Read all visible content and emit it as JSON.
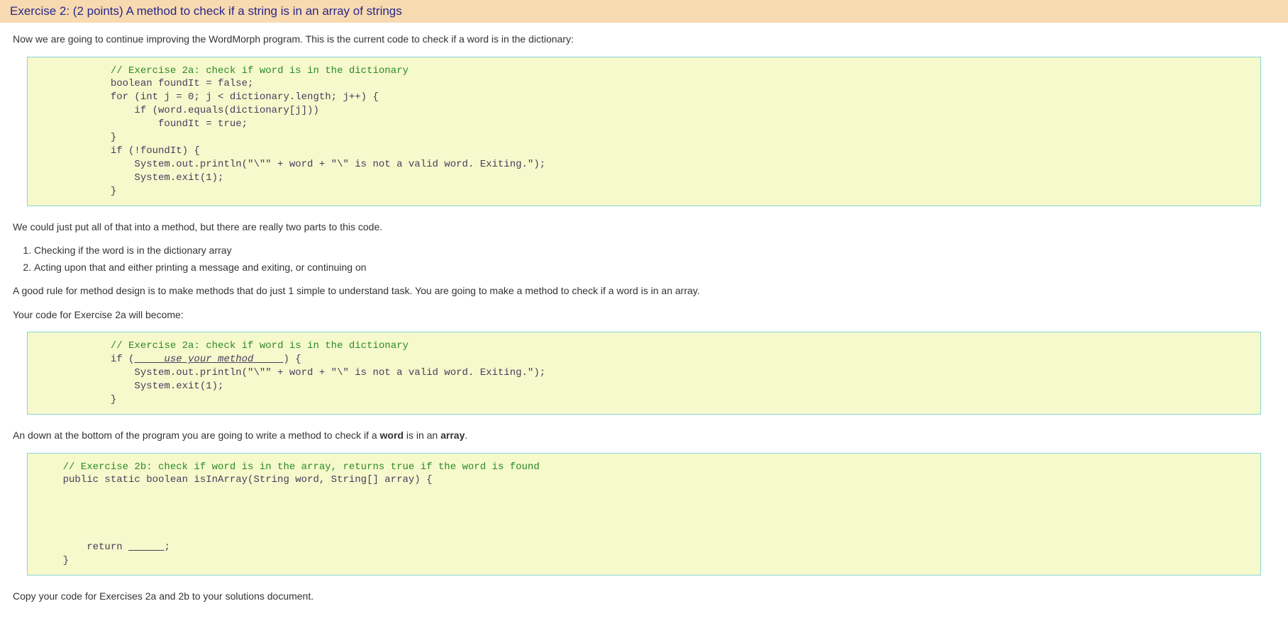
{
  "header": {
    "title": "Exercise 2: (2 points) A method to check if a string is in an array of strings"
  },
  "paragraphs": {
    "intro": "Now we are going to continue improving the WordMorph program. This is the current code to check if a word is in the dictionary:",
    "two_parts": "We could just put all of that into a method, but there are really two parts to this code.",
    "list_item_1": "Checking if the word is in the dictionary array",
    "list_item_2": "Acting upon that and either printing a message and exiting, or continuing on",
    "good_rule": "A good rule for method design is to make methods that do just 1 simple to understand task. You are going to make a method to check if a word is in an array.",
    "will_become": "Your code for Exercise 2a will become:",
    "bottom_pre": "An down at the bottom of the program you are going to write a method to check if a ",
    "bottom_word": "word",
    "bottom_mid": " is in an ",
    "bottom_array": "array",
    "bottom_end": ".",
    "copy_code": "Copy your code for Exercises 2a and 2b to your solutions document."
  },
  "code": {
    "block1_comment": "// Exercise 2a: check if word is in the dictionary",
    "block1_body": "            boolean foundIt = false;\n            for (int j = 0; j < dictionary.length; j++) {\n                if (word.equals(dictionary[j]))\n                    foundIt = true;\n            }\n            if (!foundIt) {\n                System.out.println(\"\\\"\" + word + \"\\\" is not a valid word. Exiting.\");\n                System.exit(1);\n            }",
    "block2_comment": "// Exercise 2a: check if word is in the dictionary",
    "block2_line_if_pre": "            if (",
    "block2_placeholder": "     use your method     ",
    "block2_line_if_post": ") {",
    "block2_body": "                System.out.println(\"\\\"\" + word + \"\\\" is not a valid word. Exiting.\");\n                System.exit(1);\n            }",
    "block3_comment": "    // Exercise 2b: check if word is in the array, returns true if the word is found",
    "block3_sig": "    public static boolean isInArray(String word, String[] array) {",
    "block3_return_pre": "        return ",
    "block3_blank": "      ",
    "block3_return_post": ";",
    "block3_close": "    }"
  }
}
